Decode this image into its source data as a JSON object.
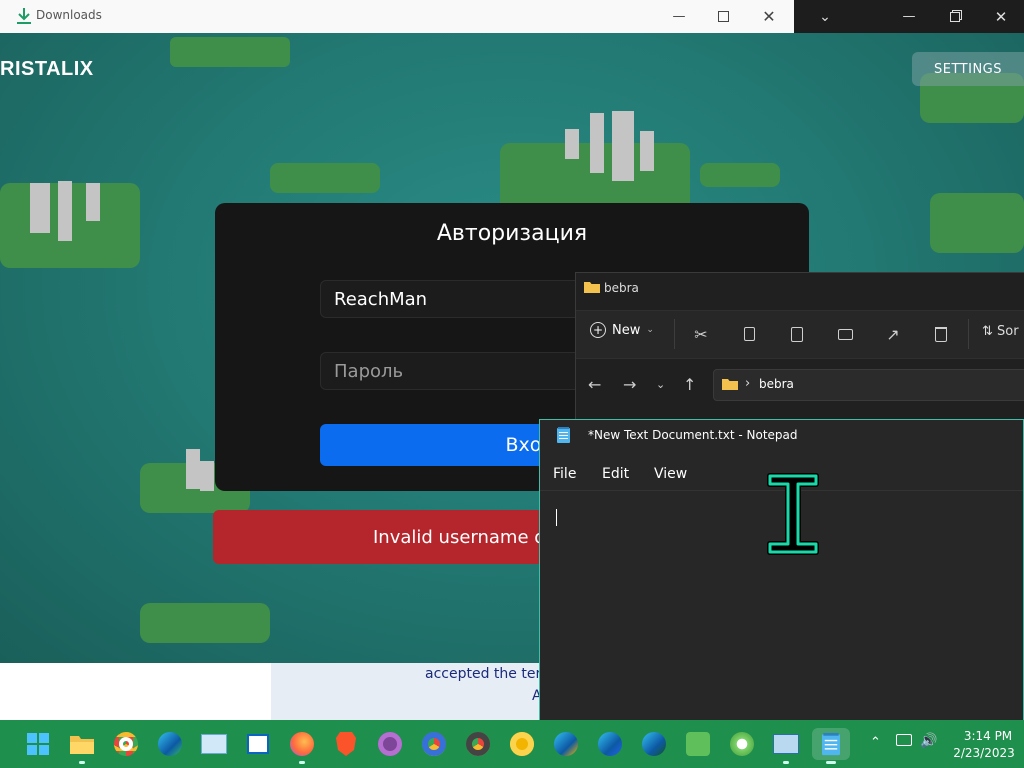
{
  "downloads_window": {
    "title": "Downloads"
  },
  "launcher": {
    "brand": "RISTALIX",
    "settings_label": "SETTINGS",
    "auth": {
      "title": "Авторизация",
      "username_value": "ReachMan",
      "password_placeholder": "Пароль",
      "login_label": "Вход",
      "error_text": "Invalid username o"
    },
    "below_text_line1": "accepted the terr",
    "below_text_line2": "A"
  },
  "explorer": {
    "title": "bebra",
    "toolbar": {
      "new_label": "New",
      "icons": [
        "cut-icon",
        "copy-icon",
        "paste-icon",
        "rename-icon",
        "share-icon",
        "delete-icon"
      ],
      "sort_label": "Sor"
    },
    "address_path": "bebra"
  },
  "notepad": {
    "title": "*New Text Document.txt - Notepad",
    "menu": [
      "File",
      "Edit",
      "View"
    ]
  },
  "taskbar": {
    "apps": [
      "start-icon",
      "file-explorer-icon",
      "chrome-icon",
      "edge-icon",
      "photos-icon",
      "store-icon",
      "firefox-icon",
      "brave-icon",
      "tor-icon",
      "chrome-beta-icon",
      "chrome-dev-icon",
      "chrome-canary-icon",
      "edge-canary-icon",
      "edge-beta-icon",
      "edge-dev-icon",
      "tool-icon",
      "cheat-engine-icon",
      "network-icon",
      "notepad-icon"
    ],
    "clock_time": "3:14 PM",
    "clock_date": "2/23/2023"
  },
  "colors": {
    "taskbar": "#1f8f4d",
    "login_button": "#0b6cf0",
    "error_banner": "#b5262c",
    "cursor": "#19d9a8"
  }
}
